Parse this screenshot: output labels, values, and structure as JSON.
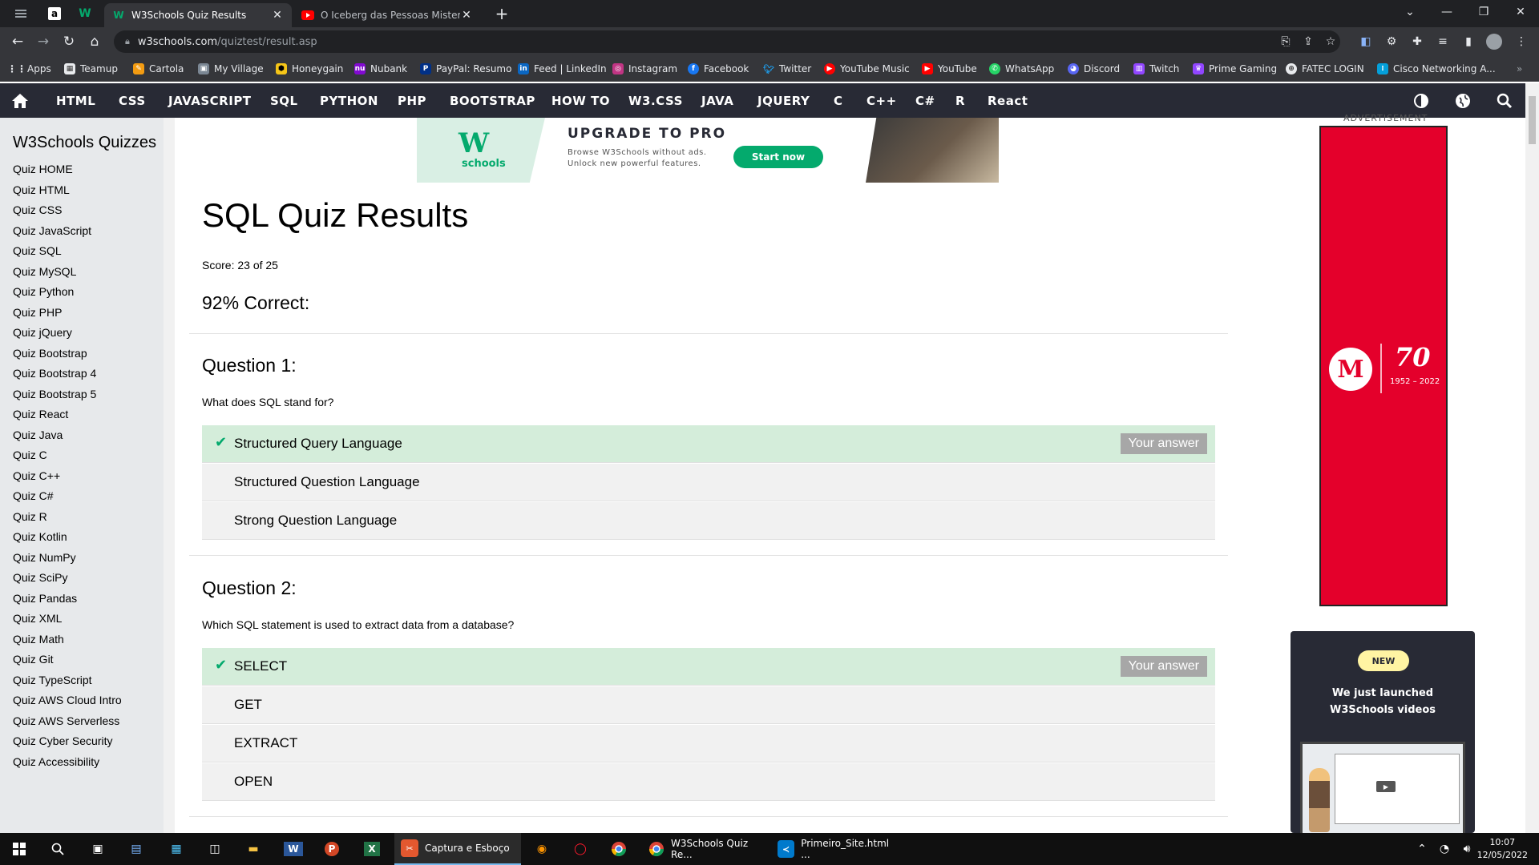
{
  "browser": {
    "tabs": [
      {
        "title": "W3Schools Quiz Results",
        "active": true
      },
      {
        "title": "O Iceberg das Pessoas Misterios",
        "active": false
      }
    ],
    "url_domain": "w3schools.com",
    "url_path": "/quiztest/result.asp",
    "bookmarks": [
      "Apps",
      "Teamup",
      "Cartola",
      "My Village",
      "Honeygain",
      "Nubank",
      "PayPal: Resumo",
      "Feed | LinkedIn",
      "Instagram",
      "Facebook",
      "Twitter",
      "YouTube Music",
      "YouTube",
      "WhatsApp",
      "Discord",
      "Twitch",
      "Prime Gaming",
      "FATEC LOGIN",
      "Cisco Networking A..."
    ]
  },
  "w3nav": {
    "links": [
      "HTML",
      "CSS",
      "JAVASCRIPT",
      "SQL",
      "PYTHON",
      "PHP",
      "BOOTSTRAP",
      "HOW TO",
      "W3.CSS",
      "JAVA",
      "JQUERY",
      "C",
      "C++",
      "C#",
      "R",
      "React"
    ]
  },
  "sidebar": {
    "title": "W3Schools Quizzes",
    "items": [
      "Quiz HOME",
      "Quiz HTML",
      "Quiz CSS",
      "Quiz JavaScript",
      "Quiz SQL",
      "Quiz MySQL",
      "Quiz Python",
      "Quiz PHP",
      "Quiz jQuery",
      "Quiz Bootstrap",
      "Quiz Bootstrap 4",
      "Quiz Bootstrap 5",
      "Quiz React",
      "Quiz Java",
      "Quiz C",
      "Quiz C++",
      "Quiz C#",
      "Quiz R",
      "Quiz Kotlin",
      "Quiz NumPy",
      "Quiz SciPy",
      "Quiz Pandas",
      "Quiz XML",
      "Quiz Math",
      "Quiz Git",
      "Quiz TypeScript",
      "Quiz AWS Cloud Intro",
      "Quiz AWS Serverless",
      "Quiz Cyber Security",
      "Quiz Accessibility"
    ]
  },
  "ad_banner": {
    "logo_text": "W",
    "logo_sub": "schools",
    "headline": "UPGRADE TO PRO",
    "line1": "Browse W3Schools without ads.",
    "line2": "Unlock new powerful features.",
    "cta": "Start now"
  },
  "main": {
    "title": "SQL Quiz Results",
    "score": "Score: 23 of 25",
    "percent": "92% Correct:",
    "your_answer_label": "Your answer",
    "questions": [
      {
        "title": "Question 1:",
        "text": "What does SQL stand for?",
        "answers": [
          "Structured Query Language",
          "Structured Question Language",
          "Strong Question Language"
        ],
        "selected": 0
      },
      {
        "title": "Question 2:",
        "text": "Which SQL statement is used to extract data from a database?",
        "answers": [
          "SELECT",
          "GET",
          "EXTRACT",
          "OPEN"
        ],
        "selected": 0
      }
    ]
  },
  "right_ads": {
    "label": "ADVERTISEMENT",
    "mack_letter": "M",
    "mack_anniv": "70",
    "mack_years": "1952 – 2022",
    "new_badge": "NEW",
    "video_line1": "We just launched",
    "video_line2": "W3Schools videos"
  },
  "taskbar": {
    "apps": [
      {
        "label": "Captura e Esboço",
        "active": true
      },
      {
        "label": "W3Schools Quiz Re...",
        "active": false
      },
      {
        "label": "Primeiro_Site.html ...",
        "active": false
      }
    ],
    "time": "10:07",
    "date": "12/05/2022"
  },
  "colors": {
    "w3_green": "#04aa6d",
    "nav_bg": "#282a35",
    "correct_bg": "#d4edda",
    "answer_bg": "#f1f1f1",
    "ad_red": "#e4002b"
  }
}
